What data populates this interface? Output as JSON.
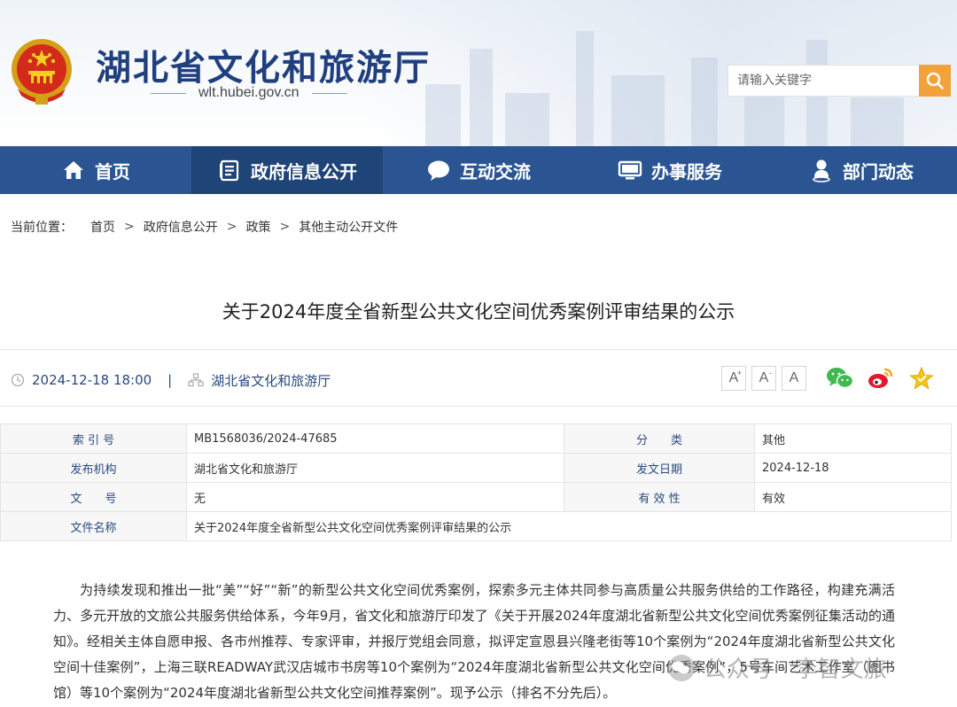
{
  "header": {
    "site_title": "湖北省文化和旅游厅",
    "site_url": "wlt.hubei.gov.cn",
    "search_placeholder": "请输入关键字"
  },
  "nav": {
    "items": [
      {
        "label": "首页",
        "icon": "home-icon"
      },
      {
        "label": "政府信息公开",
        "icon": "document-list-icon",
        "active": true
      },
      {
        "label": "互动交流",
        "icon": "chat-bubble-icon"
      },
      {
        "label": "办事服务",
        "icon": "monitor-icon"
      },
      {
        "label": "部门动态",
        "icon": "person-pin-icon"
      }
    ]
  },
  "breadcrumb": {
    "prefix": "当前位置：",
    "items": [
      "首页",
      "政府信息公开",
      "政策",
      "其他主动公开文件"
    ],
    "separator": ">"
  },
  "article": {
    "title": "关于2024年度全省新型公共文化空间优秀案例评审结果的公示",
    "date": "2024-12-18 18:00",
    "divider": "|",
    "source": "湖北省文化和旅游厅",
    "font_buttons": [
      "A",
      "A",
      "A"
    ],
    "font_button_sups": [
      "+",
      "-"
    ]
  },
  "info_table": {
    "rows": [
      {
        "k1": "索 引 号",
        "v1": "MB1568036/2024-47685",
        "k2": "分　　类",
        "v2": "其他"
      },
      {
        "k1": "发布机构",
        "v1": "湖北省文化和旅游厅",
        "k2": "发文日期",
        "v2": "2024-12-18"
      },
      {
        "k1": "文　　号",
        "v1": "无",
        "k2": "有 效 性",
        "v2": "有效"
      }
    ],
    "name_row": {
      "k": "文件名称",
      "v": "关于2024年度全省新型公共文化空间优秀案例评审结果的公示"
    }
  },
  "body": {
    "paragraph": "为持续发现和推出一批“美”“好”“新”的新型公共文化空间优秀案例，探索多元主体共同参与高质量公共服务供给的工作路径，构建充满活力、多元开放的文旅公共服务供给体系，今年9月，省文化和旅游厅印发了《关于开展2024年度湖北省新型公共文化空间优秀案例征集活动的通知》。经相关主体自愿申报、各市州推荐、专家评审，并报厅党组会同意，拟评定宣恩县兴隆老街等10个案例为“2024年度湖北省新型公共文化空间十佳案例”，上海三联READWAY武汉店城市书房等10个案例为“2024年度湖北省新型公共文化空间优秀案例”，5号车间艺术工作室（图书馆）等10个案例为“2024年度湖北省新型公共文化空间推荐案例”。现予公示（排名不分先后）。"
  },
  "watermark": {
    "text": "公众号 · 李智文旅"
  },
  "colors": {
    "nav_bg": "#2a5592",
    "nav_active": "#1f4478",
    "search_btn": "#f2a23a",
    "title_blue": "#1f3f7e"
  }
}
